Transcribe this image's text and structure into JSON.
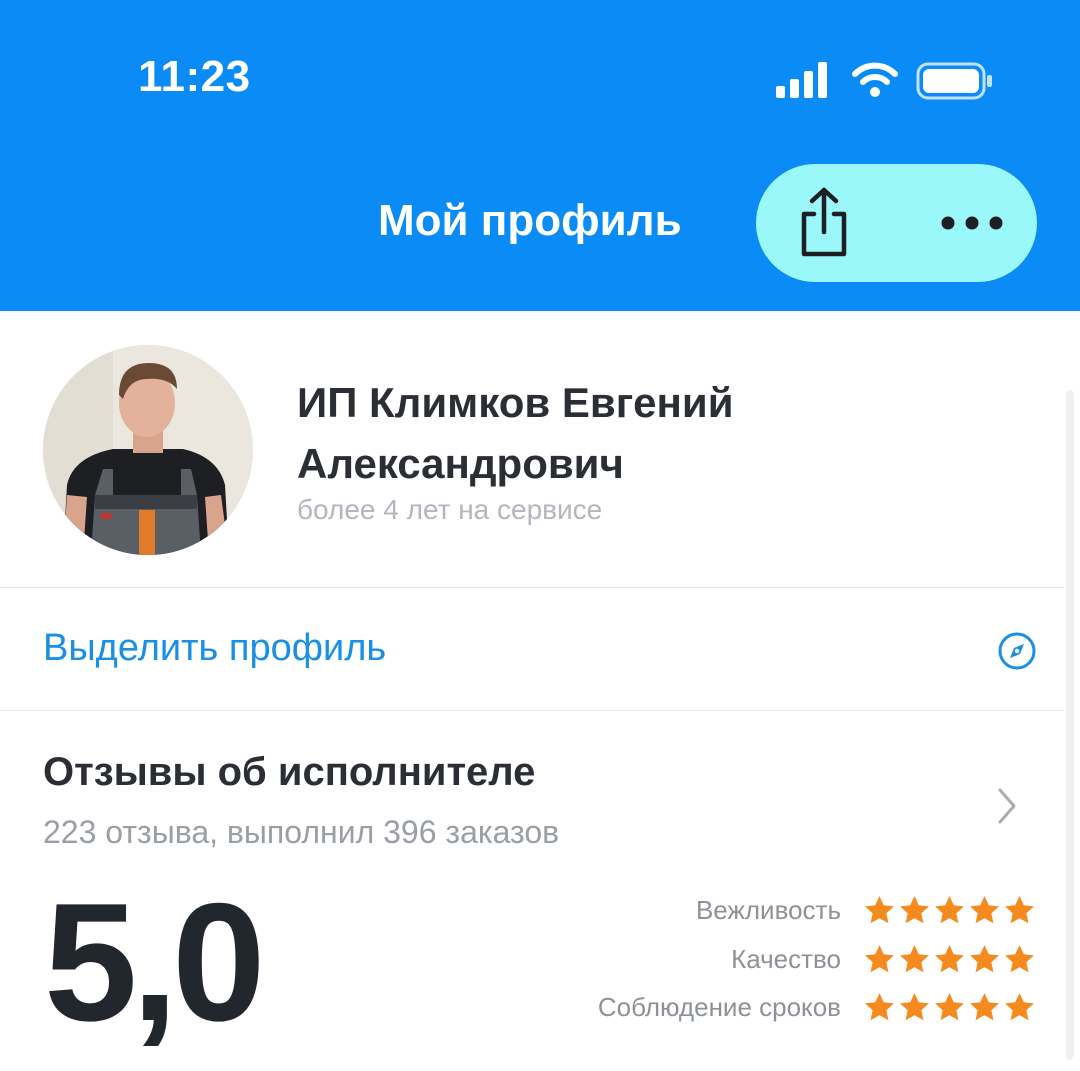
{
  "status_bar": {
    "time": "11:23"
  },
  "nav": {
    "title": "Мой профиль",
    "share_icon": "share-icon",
    "more_icon": "more-dots-icon",
    "actions_background": "#9af7fa"
  },
  "profile": {
    "name": "ИП Климков Евгений Александрович",
    "since": "более 4 лет на сервисе"
  },
  "highlight": {
    "label": "Выделить профиль",
    "icon": "compass-icon"
  },
  "reviews": {
    "title": "Отзывы об исполнителе",
    "subtitle": "223 отзыва, выполнил 396 заказов",
    "rating": "5,0",
    "categories": [
      {
        "label": "Вежливость",
        "stars": 5
      },
      {
        "label": "Качество",
        "stars": 5
      },
      {
        "label": "Соблюдение сроков",
        "stars": 5
      }
    ]
  },
  "colors": {
    "header": "#0a8bf5",
    "accent": "#1a8fe8",
    "star": "#f58a1f"
  }
}
